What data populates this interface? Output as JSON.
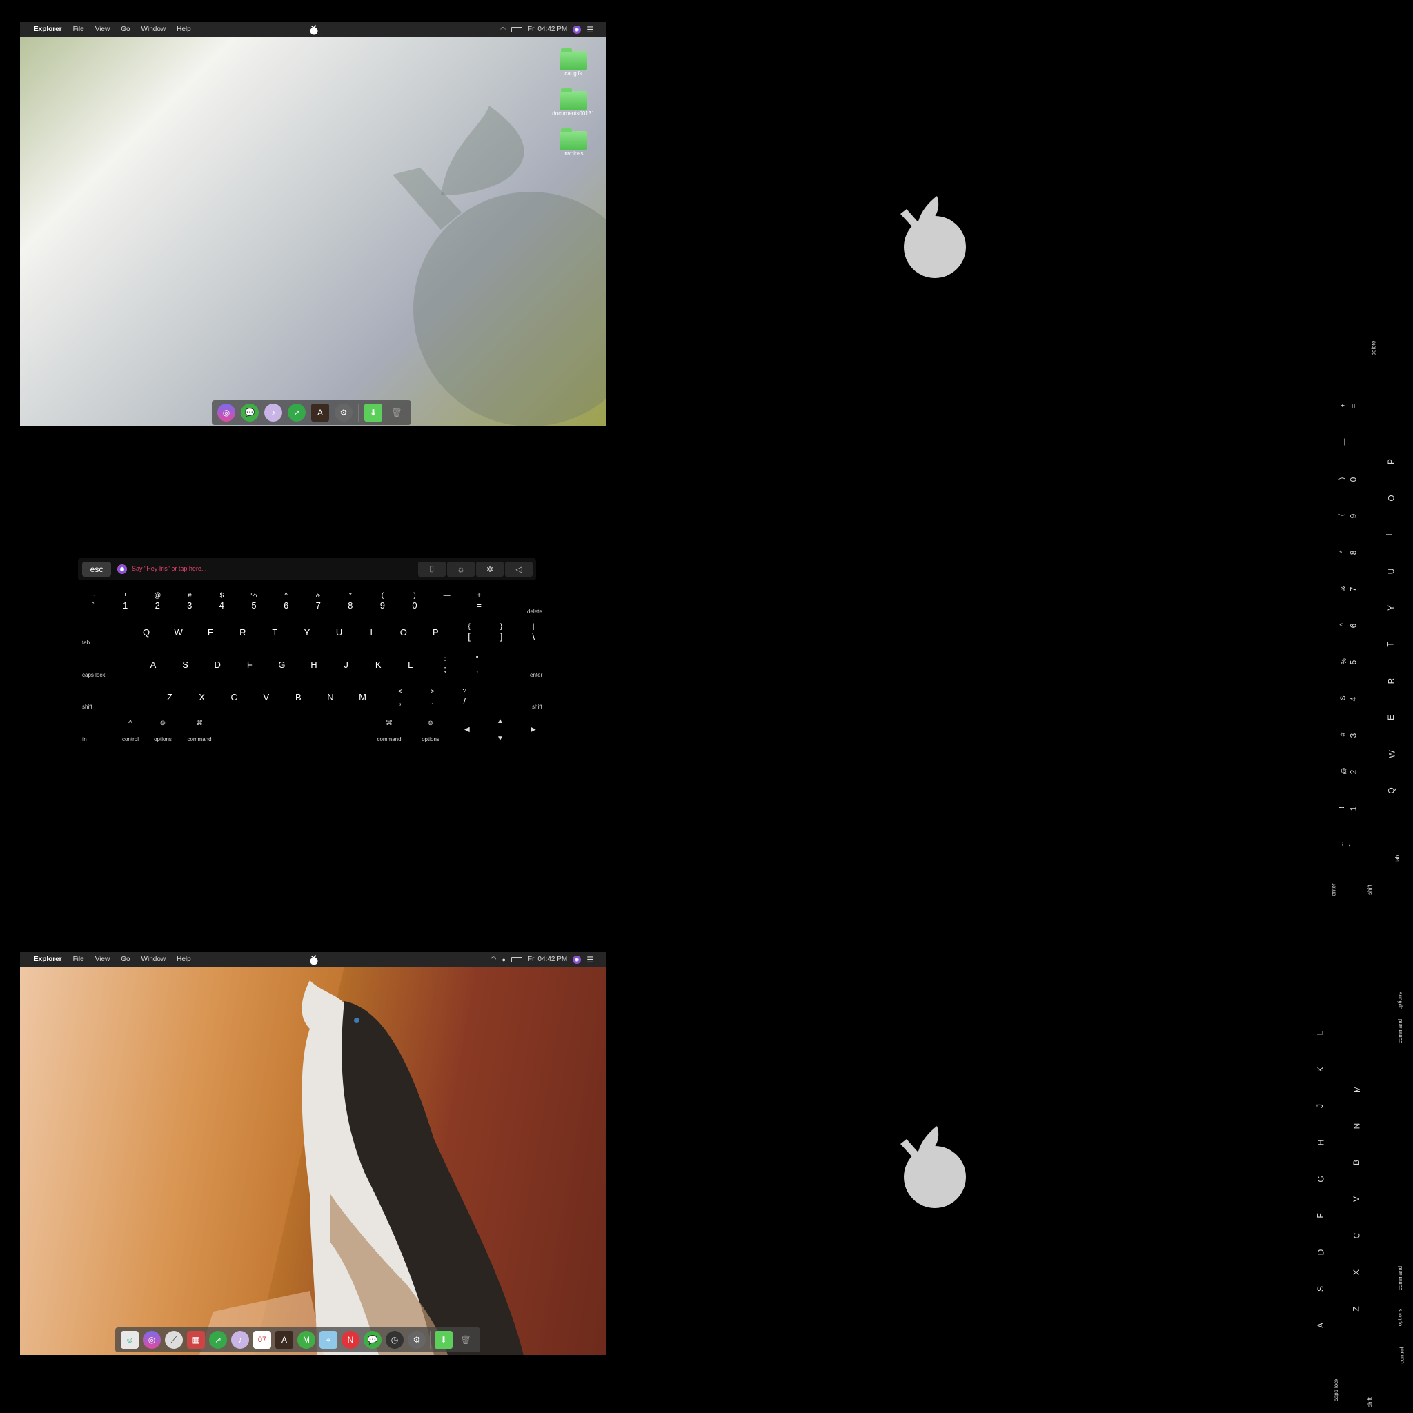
{
  "menubar": {
    "app": "Explorer",
    "items": [
      "File",
      "View",
      "Go",
      "Window",
      "Help"
    ],
    "clock": "Fri 04:42 PM"
  },
  "desktop_top": {
    "folders": [
      "cat gifs",
      "documents00131",
      "invoices"
    ]
  },
  "touchbar": {
    "esc": "esc",
    "prompt": "Say \"Hey Iris\" or tap here..."
  },
  "keyboard": {
    "num_row": [
      {
        "s": "~",
        "m": "`"
      },
      {
        "s": "!",
        "m": "1"
      },
      {
        "s": "@",
        "m": "2"
      },
      {
        "s": "#",
        "m": "3"
      },
      {
        "s": "$",
        "m": "4"
      },
      {
        "s": "%",
        "m": "5"
      },
      {
        "s": "^",
        "m": "6"
      },
      {
        "s": "&",
        "m": "7"
      },
      {
        "s": "*",
        "m": "8"
      },
      {
        "s": "(",
        "m": "9"
      },
      {
        "s": ")",
        "m": "0"
      },
      {
        "s": "—",
        "m": "–"
      },
      {
        "s": "+",
        "m": "="
      }
    ],
    "row_q": [
      "Q",
      "W",
      "E",
      "R",
      "T",
      "Y",
      "U",
      "I",
      "O",
      "P"
    ],
    "row_q_sym": [
      {
        "s": "{",
        "m": "["
      },
      {
        "s": "}",
        "m": "]"
      },
      {
        "s": "|",
        "m": "\\"
      }
    ],
    "row_a": [
      "A",
      "S",
      "D",
      "F",
      "G",
      "H",
      "J",
      "K",
      "L"
    ],
    "row_a_sym": [
      {
        "s": ":",
        "m": ";"
      },
      {
        "s": "\"",
        "m": ","
      }
    ],
    "row_z": [
      "Z",
      "X",
      "C",
      "V",
      "B",
      "N",
      "M"
    ],
    "row_z_sym": [
      {
        "s": "<",
        "m": ","
      },
      {
        "s": ">",
        "m": "."
      },
      {
        "s": "?",
        "m": "/"
      }
    ],
    "labels": {
      "delete": "delete",
      "tab": "tab",
      "caps": "caps lock",
      "enter": "enter",
      "shift": "shift",
      "fn": "fn",
      "control": "control",
      "options": "options",
      "command": "command"
    }
  },
  "colors": {
    "folder": "#5ccf5a",
    "menubar": "#262626",
    "prompt": "#e3456c"
  }
}
